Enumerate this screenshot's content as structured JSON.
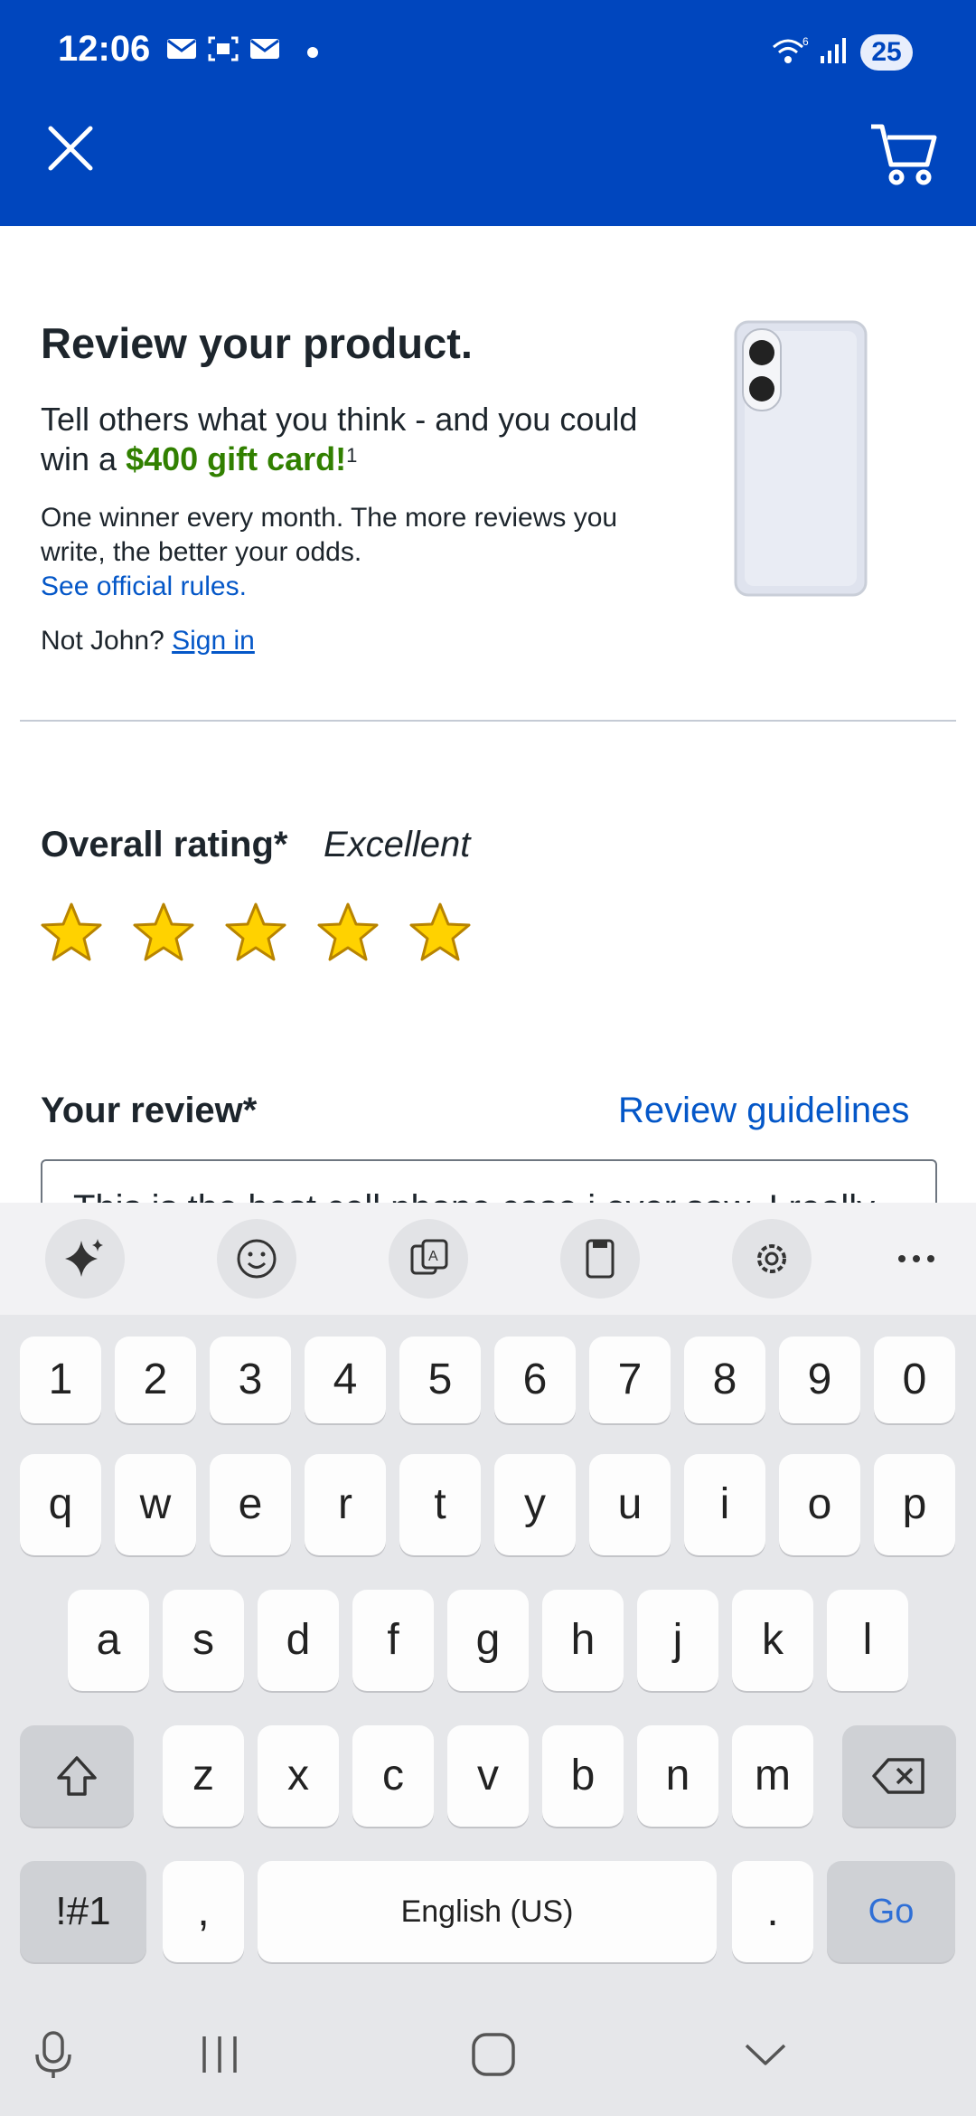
{
  "status_bar": {
    "time": "12:06",
    "battery": "25"
  },
  "header": {
    "close_icon": "close-icon",
    "cart_icon": "cart-icon",
    "background": "#0046be"
  },
  "review_intro": {
    "title": "Review your product.",
    "line1": "Tell others what you think - and you could win a",
    "gift": "$400 gift card!",
    "sup": "1",
    "line2": "One winner every month. The more reviews you write, the better your odds.",
    "rules_link": "See official rules.",
    "not_user": "Not John?",
    "sign_in": "Sign in"
  },
  "rating": {
    "label": "Overall rating*",
    "value": "Excellent",
    "stars": 5,
    "max_stars": 5
  },
  "review": {
    "label": "Your review*",
    "guidelines_link": "Review guidelines",
    "text": "This is the best cell phone case i ever saw. I really"
  },
  "keyboard": {
    "toolbar": [
      "sparkle-icon",
      "emoji-icon",
      "translate-icon",
      "clipboard-icon",
      "settings-icon",
      "more-icon"
    ],
    "row_numbers": [
      "1",
      "2",
      "3",
      "4",
      "5",
      "6",
      "7",
      "8",
      "9",
      "0"
    ],
    "row1": [
      "q",
      "w",
      "e",
      "r",
      "t",
      "y",
      "u",
      "i",
      "o",
      "p"
    ],
    "row2": [
      "a",
      "s",
      "d",
      "f",
      "g",
      "h",
      "j",
      "k",
      "l"
    ],
    "row3": [
      "z",
      "x",
      "c",
      "v",
      "b",
      "n",
      "m"
    ],
    "symbols": "!#1",
    "comma": ",",
    "space": "English (US)",
    "period": ".",
    "go": "Go"
  },
  "nav_bar": [
    "mic-icon",
    "recents-icon",
    "home-icon",
    "back-chevron-icon"
  ]
}
